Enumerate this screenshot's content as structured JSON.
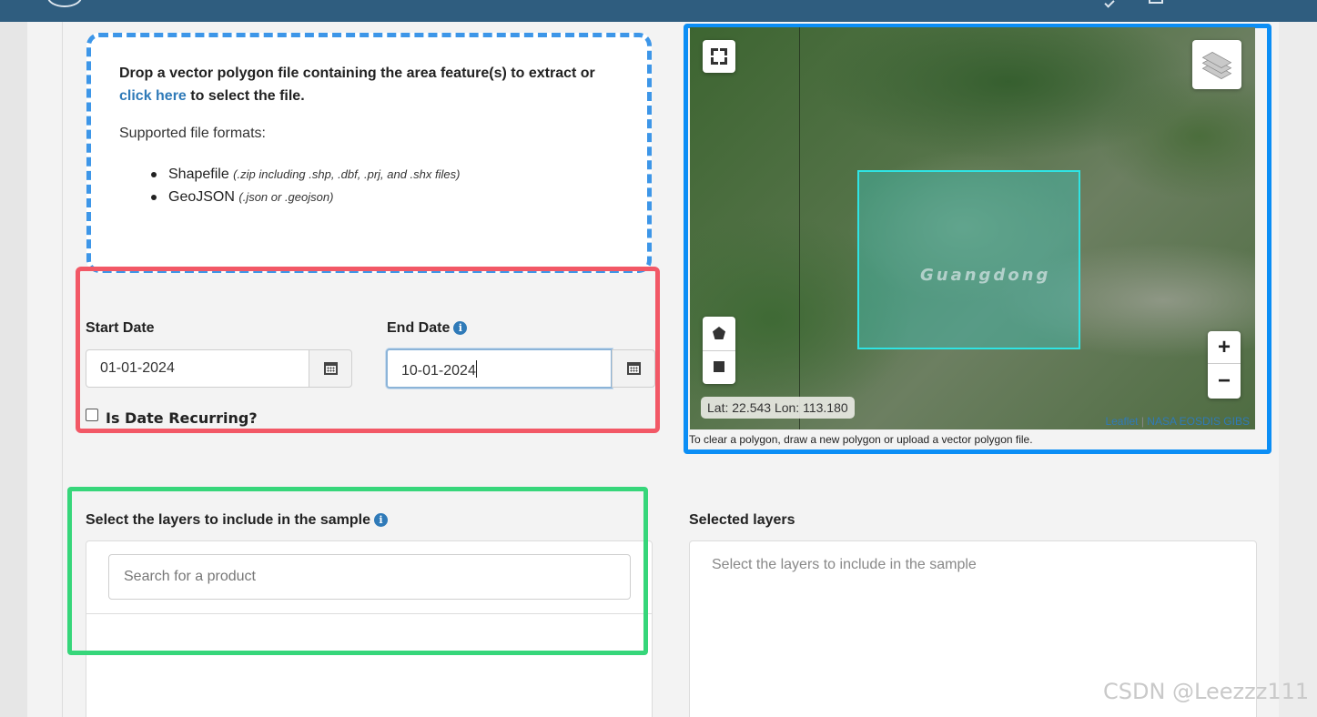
{
  "dropzone": {
    "instruction_prefix": "Drop a vector polygon file containing the area feature(s) to extract or ",
    "link": "click here",
    "instruction_suffix": " to select the file.",
    "formats_label": "Supported file formats:",
    "formats": [
      {
        "name": "Shapefile",
        "detail": "(.zip including .shp, .dbf, .prj, and .shx files)"
      },
      {
        "name": "GeoJSON",
        "detail": "(.json or .geojson)"
      }
    ]
  },
  "dates": {
    "start_label": "Start Date",
    "start_value": "01-01-2024",
    "end_label": "End Date",
    "end_value": "10-01-2024",
    "recurring_label": "Is Date Recurring?",
    "recurring_checked": false
  },
  "map": {
    "region_label": "Guangdong",
    "coords": "Lat: 22.543 Lon: 113.180",
    "zoom_in": "+",
    "zoom_out": "−",
    "attribution": [
      "Leaflet",
      "|",
      "NASA EOSDIS GIBS"
    ],
    "note": "To clear a polygon, draw a new polygon or upload a vector polygon file."
  },
  "layers": {
    "select_label": "Select the layers to include in the sample",
    "search_placeholder": "Search for a product",
    "selected_label": "Selected layers",
    "selected_hint": "Select the layers to include in the sample"
  },
  "watermark": "CSDN @Leezzz111",
  "colors": {
    "header": "#2f5d7f",
    "link": "#2f7ab8",
    "dropzone_border": "#3d96e8",
    "highlight_red": "#f25866",
    "highlight_blue": "#0b8ef5",
    "highlight_green": "#36d67a",
    "aoi": "#2fe4e4"
  },
  "icons": [
    "logo-icon",
    "info-icon",
    "calendar-icon",
    "fullscreen-icon",
    "layers-icon",
    "draw-polygon-icon",
    "draw-rectangle-icon"
  ]
}
